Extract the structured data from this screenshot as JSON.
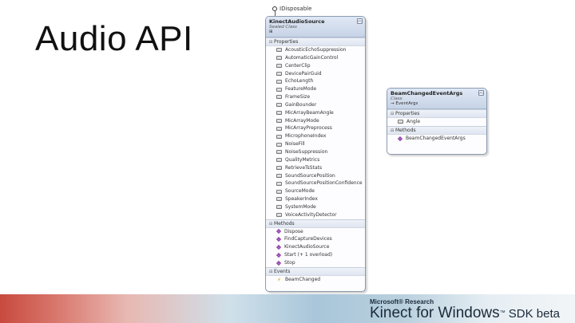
{
  "slide": {
    "title": "Audio API"
  },
  "interface": {
    "name": "IDisposable"
  },
  "kinect_class": {
    "name": "KinectAudioSource",
    "kind": "Sealed Class",
    "sections": {
      "properties": {
        "label": "Properties",
        "items": [
          "AcousticEchoSuppression",
          "AutomaticGainControl",
          "CenterClip",
          "DevicePairGuid",
          "EchoLength",
          "FeatureMode",
          "FrameSize",
          "GainBounder",
          "MicArrayBeamAngle",
          "MicArrayMode",
          "MicArrayPreprocess",
          "MicrophoneIndex",
          "NoiseFill",
          "NoiseSuppression",
          "QualityMetrics",
          "RetrieveTsStats",
          "SoundSourcePosition",
          "SoundSourcePositionConfidence",
          "SourceMode",
          "SpeakerIndex",
          "SystemMode",
          "VoiceActivityDetector"
        ]
      },
      "methods": {
        "label": "Methods",
        "items": [
          "Dispose",
          "FindCaptureDevices",
          "KinectAudioSource",
          "Start (+ 1 overload)",
          "Stop"
        ]
      },
      "events": {
        "label": "Events",
        "items": [
          "BeamChanged"
        ]
      }
    }
  },
  "beam_class": {
    "name": "BeamChangedEventArgs",
    "kind": "Class",
    "base": "EventArgs",
    "sections": {
      "properties": {
        "label": "Properties",
        "items": [
          "Angle"
        ]
      },
      "methods": {
        "label": "Methods",
        "items": [
          "BeamChangedEventArgs"
        ]
      }
    }
  },
  "banner": {
    "company": "Microsoft® Research",
    "product_main": "Kinect for Windows",
    "product_tm": "™",
    "product_tail": " SDK beta"
  }
}
